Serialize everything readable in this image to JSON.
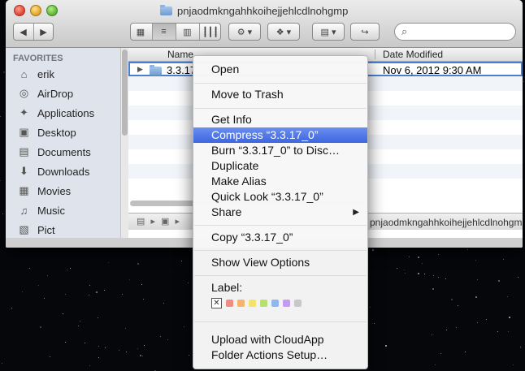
{
  "window": {
    "title": "pnjaodmkngahhkoihejjehlcdlnohgmp",
    "search_placeholder": ""
  },
  "toolbar": {
    "back_icon": "◀",
    "forward_icon": "▶",
    "view_icon_mode": "▦",
    "view_list_mode": "≡",
    "view_column_mode": "▥",
    "view_coverflow_mode": "┃┃┃",
    "action_icon": "⚙ ▾",
    "dropbox_icon": "❖ ▾",
    "arrange_icon": "▤ ▾",
    "share_icon": "↪"
  },
  "sidebar": {
    "header": "FAVORITES",
    "items": [
      {
        "label": "erik",
        "icon": "home-icon",
        "glyph": "⌂"
      },
      {
        "label": "AirDrop",
        "icon": "airdrop-icon",
        "glyph": "◎"
      },
      {
        "label": "Applications",
        "icon": "applications-icon",
        "glyph": "✦"
      },
      {
        "label": "Desktop",
        "icon": "desktop-icon",
        "glyph": "▣"
      },
      {
        "label": "Documents",
        "icon": "documents-icon",
        "glyph": "▤"
      },
      {
        "label": "Downloads",
        "icon": "downloads-icon",
        "glyph": "⬇"
      },
      {
        "label": "Movies",
        "icon": "movies-icon",
        "glyph": "▦"
      },
      {
        "label": "Music",
        "icon": "music-icon",
        "glyph": "♫"
      },
      {
        "label": "Pict",
        "icon": "pictures-icon",
        "glyph": "▧"
      }
    ]
  },
  "list": {
    "col_name": "Name",
    "col_date": "Date Modified",
    "rows": [
      {
        "name": "3.3.17",
        "date": "Nov 6, 2012 9:30 AM"
      }
    ],
    "path_text": "pnjaodmkngahhkoihejjehlcdlnohgmp"
  },
  "menu": {
    "open": "Open",
    "trash": "Move to Trash",
    "get_info": "Get Info",
    "compress": "Compress “3.3.17_0”",
    "burn": "Burn “3.3.17_0” to Disc…",
    "duplicate": "Duplicate",
    "make_alias": "Make Alias",
    "quick_look": "Quick Look “3.3.17_0”",
    "share": "Share",
    "copy": "Copy “3.3.17_0”",
    "view_options": "Show View Options",
    "label": "Label:",
    "label_clear": "✕",
    "label_colors": [
      "#f28b82",
      "#f7b36b",
      "#f3e36a",
      "#b8e06e",
      "#8fb8f0",
      "#c29cf0",
      "#c8c8c8"
    ],
    "cloudapp": "Upload with CloudApp",
    "folder_actions": "Folder Actions Setup…"
  },
  "colors": {
    "highlight": "#3d66e0",
    "selection_border": "#4a7fd0"
  }
}
